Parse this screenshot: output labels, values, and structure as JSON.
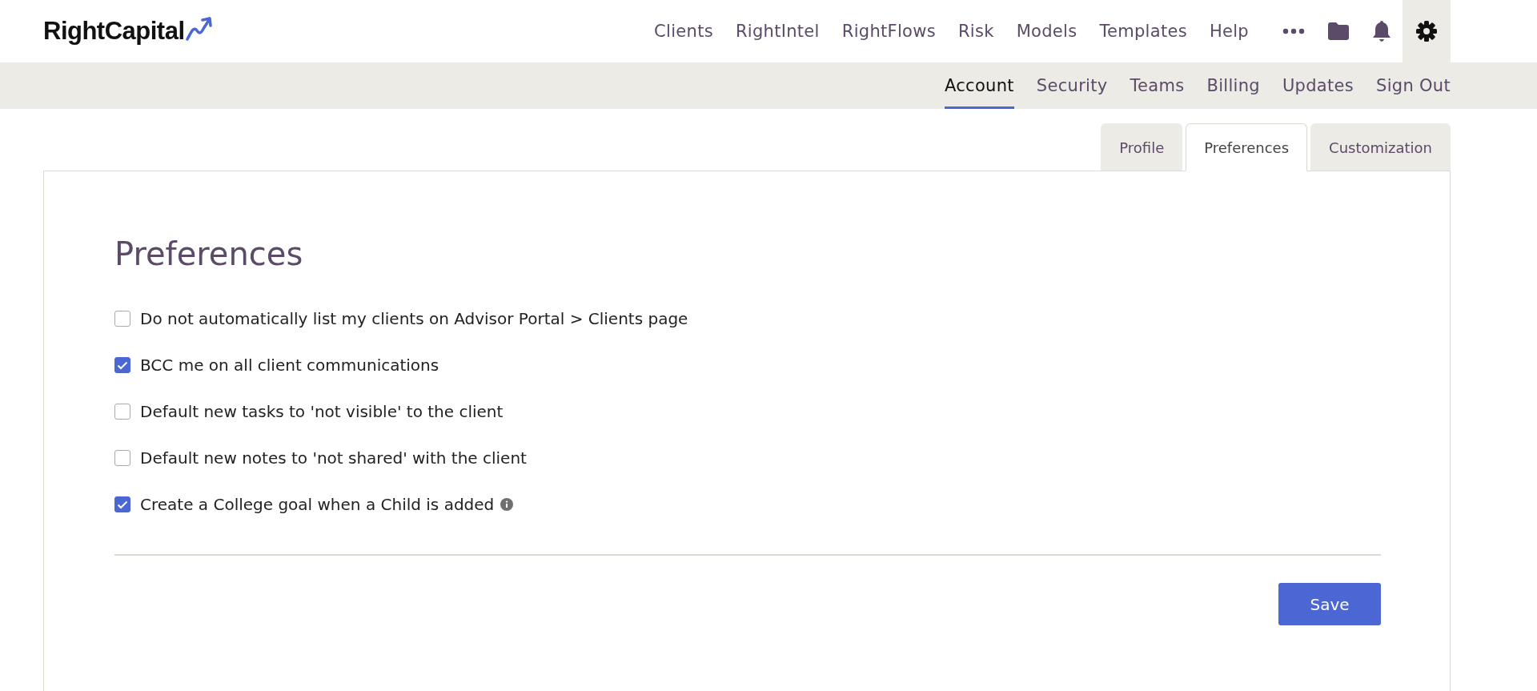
{
  "logo": {
    "text": "RightCapital"
  },
  "top_nav": [
    {
      "label": "Clients"
    },
    {
      "label": "RightIntel"
    },
    {
      "label": "RightFlows"
    },
    {
      "label": "Risk"
    },
    {
      "label": "Models"
    },
    {
      "label": "Templates"
    },
    {
      "label": "Help"
    }
  ],
  "top_icons": [
    {
      "kind": "more",
      "selected": false
    },
    {
      "kind": "folder",
      "selected": false
    },
    {
      "kind": "bell",
      "selected": false
    },
    {
      "kind": "gear",
      "selected": true
    }
  ],
  "sub_nav": [
    {
      "label": "Account",
      "selected": true
    },
    {
      "label": "Security",
      "selected": false
    },
    {
      "label": "Teams",
      "selected": false
    },
    {
      "label": "Billing",
      "selected": false
    },
    {
      "label": "Updates",
      "selected": false
    },
    {
      "label": "Sign Out",
      "selected": false
    }
  ],
  "tabs": [
    {
      "label": "Profile",
      "selected": false
    },
    {
      "label": "Preferences",
      "selected": true
    },
    {
      "label": "Customization",
      "selected": false
    }
  ],
  "heading": "Preferences",
  "options": [
    {
      "label": "Do not automatically list my clients on Advisor Portal > Clients page",
      "checked": false,
      "info": false
    },
    {
      "label": "BCC me on all client communications",
      "checked": true,
      "info": false
    },
    {
      "label": "Default new tasks to 'not visible' to the client",
      "checked": false,
      "info": false
    },
    {
      "label": "Default new notes to 'not shared' with the client",
      "checked": false,
      "info": false
    },
    {
      "label": "Create a College goal when a Child is added",
      "checked": true,
      "info": true
    }
  ],
  "save_button": "Save"
}
